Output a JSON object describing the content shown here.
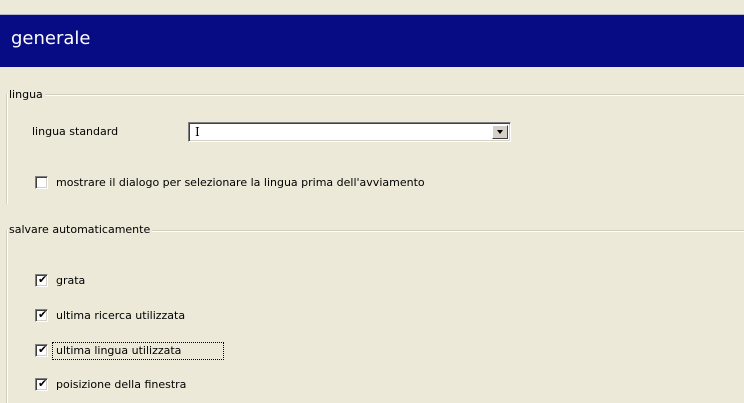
{
  "header": {
    "title": "generale"
  },
  "language_group": {
    "legend": "lingua",
    "standard_language_label": "lingua standard",
    "standard_language_value": "I",
    "show_dialog_label": "mostrare il dialogo per selezionare la lingua prima dell'avviamento",
    "show_dialog_checked": false
  },
  "autosave_group": {
    "legend": "salvare automaticamente",
    "items": [
      {
        "label": "grata",
        "checked": true
      },
      {
        "label": "ultima ricerca utilizzata",
        "checked": true
      },
      {
        "label": "ultima lingua utilizzata",
        "checked": true
      },
      {
        "label": "poisizione della finestra",
        "checked": true
      }
    ]
  },
  "colors": {
    "header_bg": "#070b84",
    "dialog_bg": "#ece9d8"
  }
}
